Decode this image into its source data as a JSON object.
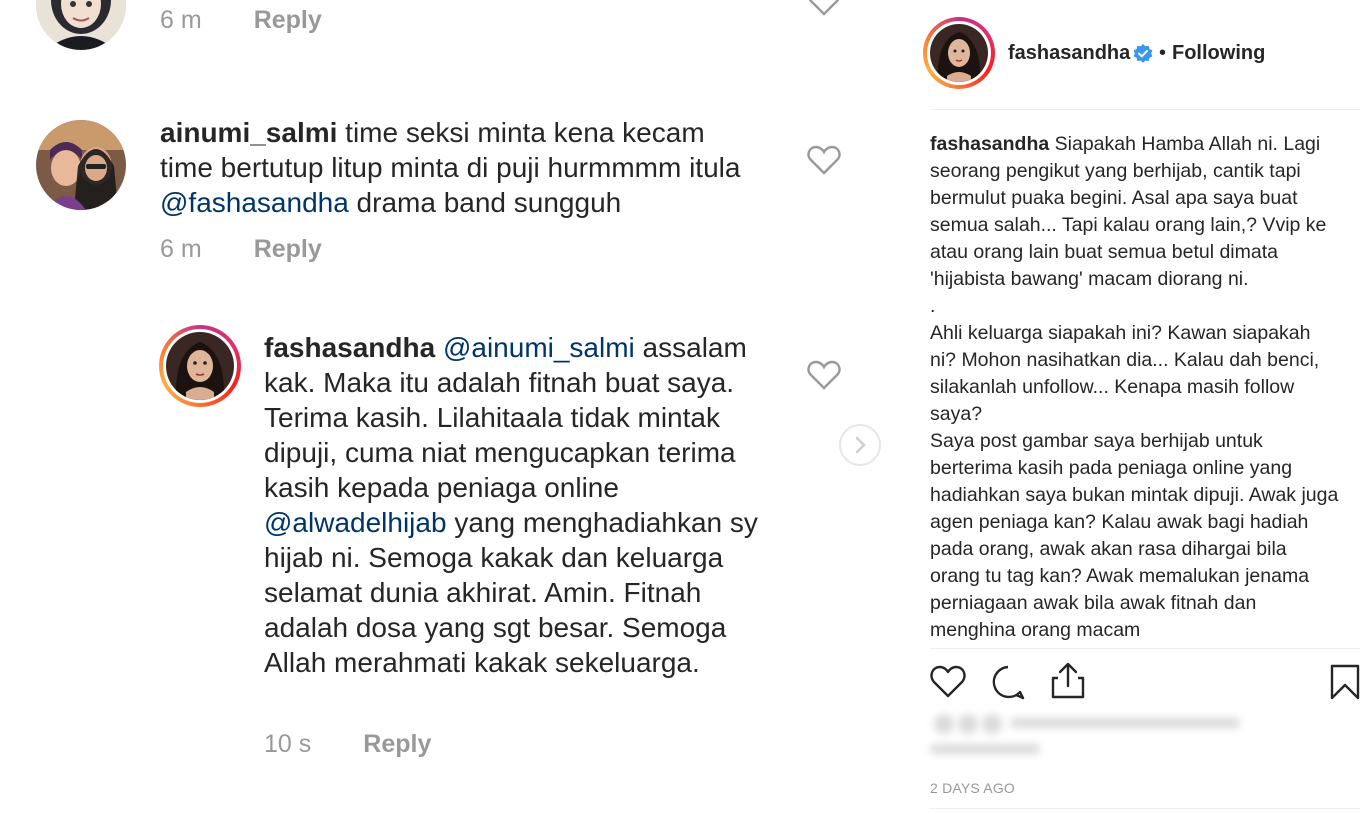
{
  "comments": [
    {
      "meta": {
        "time": "6 m",
        "reply": "Reply"
      }
    },
    {
      "user": "ainumi_salmi",
      "text_before": " time seksi minta kena kecam time bertutup litup minta di puji hurmmmm itula ",
      "mention": "@fashasandha",
      "text_after": " drama band sungguh",
      "meta": {
        "time": "6 m",
        "reply": "Reply"
      }
    },
    {
      "user": "fashasandha",
      "mention1": "@ainumi_salmi",
      "text1": " assalam kak. Maka itu adalah fitnah buat saya. Terima kasih. Lilahitaala tidak  mintak dipuji, cuma niat mengucapkan terima kasih kepada peniaga online ",
      "mention2": "@alwadelhijab",
      "text2": " yang menghadiahkan sy hijab ni. Semoga kakak dan keluarga selamat dunia akhirat. Amin. Fitnah adalah dosa yang sgt besar. Semoga Allah merahmati kakak sekeluarga.",
      "meta": {
        "time": "10 s",
        "reply": "Reply"
      }
    }
  ],
  "post": {
    "username": "fashasandha",
    "dot": "•",
    "following": "Following",
    "caption_user": "fashasandha",
    "caption_paragraphs": [
      " Siapakah Hamba Allah ni. Lagi seorang pengikut yang berhijab, cantik tapi bermulut puaka begini. Asal apa saya buat semua salah... Tapi kalau orang lain,? Vvip ke atau orang lain buat semua betul dimata 'hijabista bawang' macam diorang ni.",
      ".",
      "Ahli keluarga siapakah ini? Kawan siapakah ni? Mohon nasihatkan dia... Kalau dah benci, silakanlah unfollow... Kenapa masih follow saya?",
      "Saya post gambar saya berhijab untuk berterima kasih pada peniaga online yang hadiahkan saya bukan mintak dipuji. Awak juga agen peniaga kan? Kalau awak bagi hadiah pada orang, awak akan rasa dihargai bila orang tu tag kan? Awak memalukan jenama perniagaan awak bila awak fitnah dan menghina orang macam"
    ],
    "timestamp": "2 DAYS AGO"
  },
  "colors": {
    "mention": "#003569",
    "verified": "#3897f0",
    "muted": "#999999"
  }
}
